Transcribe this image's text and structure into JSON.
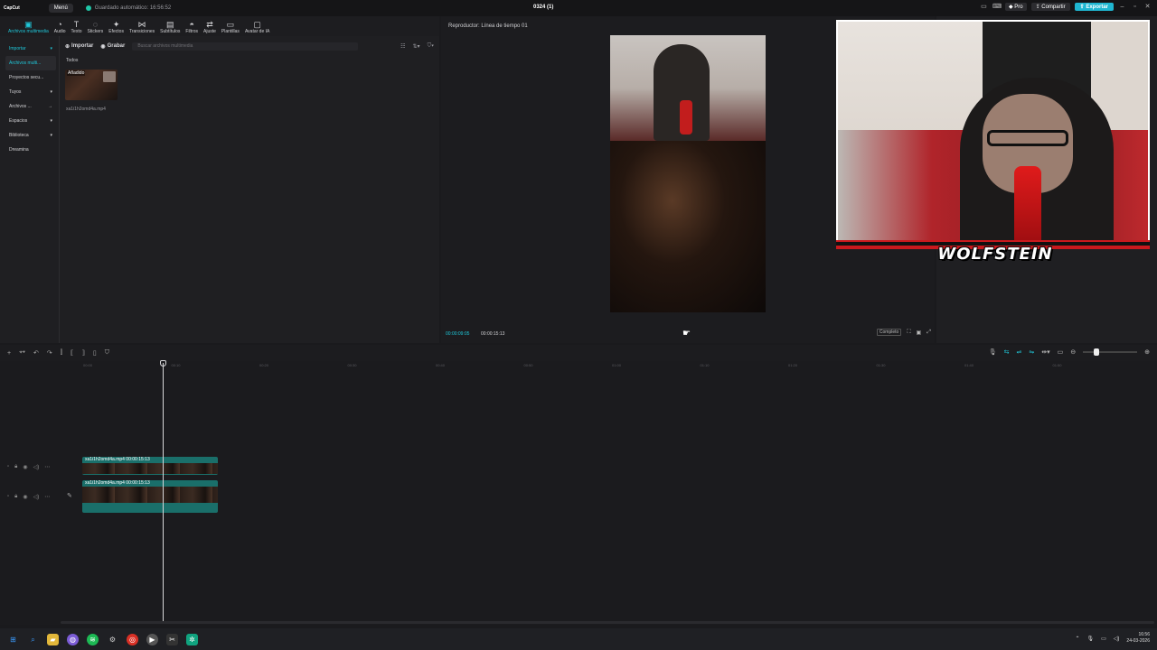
{
  "app": {
    "logo": "CapCut",
    "menu_label": "Menú",
    "autosave_text": "Guardado automático: 16:56:52",
    "project_name": "0324 (1)",
    "pro_label": "Pro",
    "share_label": "Compartir",
    "export_label": "Exportar"
  },
  "toolbar": {
    "tools": [
      {
        "label": "Archivos multimedia",
        "icon": "media-icon",
        "glyph": "▣"
      },
      {
        "label": "Audio",
        "icon": "audio-icon",
        "glyph": "◔"
      },
      {
        "label": "Texto",
        "icon": "text-icon",
        "glyph": "T"
      },
      {
        "label": "Stickers",
        "icon": "sticker-icon",
        "glyph": "◌"
      },
      {
        "label": "Efectos",
        "icon": "effects-icon",
        "glyph": "✦"
      },
      {
        "label": "Transiciones",
        "icon": "transition-icon",
        "glyph": "⋈"
      },
      {
        "label": "Subtítulos",
        "icon": "subtitles-icon",
        "glyph": "▤"
      },
      {
        "label": "Filtros",
        "icon": "filters-icon",
        "glyph": "◓"
      },
      {
        "label": "Ajuste",
        "icon": "adjust-icon",
        "glyph": "⇄"
      },
      {
        "label": "Plantillas",
        "icon": "templates-icon",
        "glyph": "▭"
      },
      {
        "label": "Avatar de IA",
        "icon": "avatar-icon",
        "glyph": "▢"
      }
    ]
  },
  "media": {
    "nav": [
      {
        "label": "Importar",
        "arrow": "▾"
      },
      {
        "label": "Archivos multi...",
        "arrow": ""
      },
      {
        "label": "Proyectos secu...",
        "arrow": ""
      },
      {
        "label": "Tuyos",
        "arrow": "▾"
      },
      {
        "label": "Archivos ...",
        "arrow": "→"
      },
      {
        "label": "Espacios",
        "arrow": "▾"
      },
      {
        "label": "Biblioteca",
        "arrow": "▾"
      },
      {
        "label": "Dreamina",
        "arrow": ""
      }
    ],
    "import_tab": "Importar",
    "record_tab": "Grabar",
    "search_placeholder": "Buscar archivos multimedia",
    "filter_all": "Todos",
    "thumb_badge": "Añadido",
    "file_name": "xa1i1h2omd4a.mp4"
  },
  "player": {
    "title": "Reproductor: Línea de tiempo 01",
    "current_time": "00:00:09:05",
    "total_time": "00:00:15:13",
    "ratio_label": "Completo"
  },
  "overlay": {
    "brand_text": "WOLFSTEIN"
  },
  "timeline": {
    "ruler": [
      "00:00",
      "00:10",
      "00:20",
      "00:30",
      "00:40",
      "00:50",
      "01:00",
      "01:10",
      "01:20",
      "01:30",
      "01:40",
      "01:50"
    ],
    "clips": [
      {
        "label": "xa1i1h2omd4a.mp4  00:00:15:13"
      },
      {
        "label": "xa1i1h2omd4a.mp4  00:00:15:13"
      }
    ]
  },
  "taskbar": {
    "time": "16:56",
    "date": "24-03-2026"
  }
}
